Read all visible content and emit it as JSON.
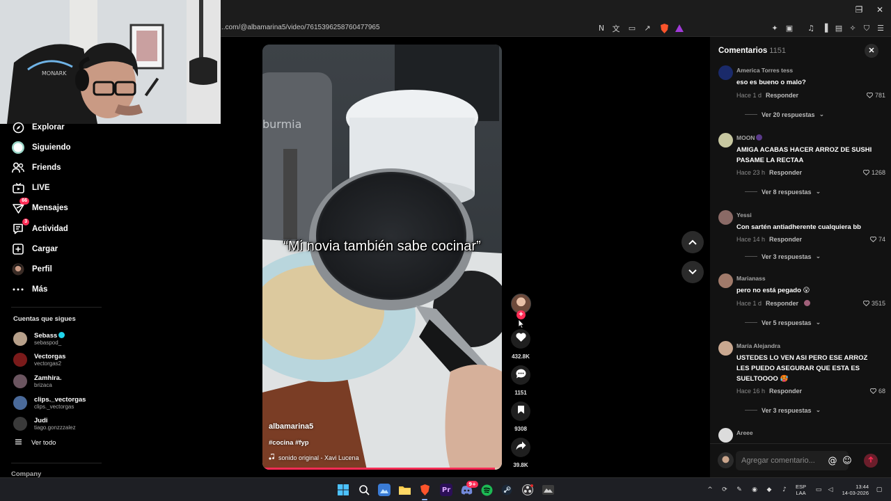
{
  "browser": {
    "url": "..com/@albamarina5/video/7615396258760477965",
    "window_controls": {
      "minimize": "─",
      "maximize": "❐",
      "close": "✕"
    }
  },
  "sidebar": {
    "nav": [
      {
        "label": "Explorar",
        "icon": "compass-icon"
      },
      {
        "label": "Siguiendo",
        "icon": "following-icon"
      },
      {
        "label": "Friends",
        "icon": "friends-icon"
      },
      {
        "label": "LIVE",
        "icon": "live-icon"
      },
      {
        "label": "Mensajes",
        "icon": "messages-icon",
        "badge": "66"
      },
      {
        "label": "Actividad",
        "icon": "activity-icon",
        "badge": "3"
      },
      {
        "label": "Cargar",
        "icon": "upload-icon"
      },
      {
        "label": "Perfil",
        "icon": "profile-icon"
      },
      {
        "label": "Más",
        "icon": "more-icon"
      }
    ],
    "following_title": "Cuentas que sigues",
    "accounts": [
      {
        "name": "Sebass",
        "handle": "sebaspod_",
        "verified": true,
        "color": "#b7a08a"
      },
      {
        "name": "Vectorgas",
        "handle": "vectorgas2",
        "verified": false,
        "color": "#7a1a1a"
      },
      {
        "name": "Zamhira.",
        "handle": "brizaca",
        "verified": false,
        "color": "#6b5560"
      },
      {
        "name": "clips._vectorgas",
        "handle": "clips._vectorgas",
        "verified": false,
        "color": "#4a6a9a"
      },
      {
        "name": "Judi",
        "handle": "tiago.gonzzzalez",
        "verified": false,
        "color": "#3a3a3a"
      }
    ],
    "see_all": "Ver todo",
    "company": "Company"
  },
  "video": {
    "caption": "“Mi novia también sabe cocinar”",
    "author": "albamarina5",
    "tags": "#cocina #fyp",
    "sound": "sonido original - Xavi Lucena",
    "progress": 0.97,
    "likes": "432.8K",
    "comments": "1151",
    "saves": "9308",
    "shares": "39.8K"
  },
  "comments_panel": {
    "title": "Comentarios",
    "count": "1151",
    "items": [
      {
        "user": "America Torres tess",
        "text": "eso es bueno o malo?",
        "time": "Hace 1 d",
        "reply": "Responder",
        "likes": "781",
        "more": "Ver 20 respuestas",
        "avatar_color": "#1a2a6a"
      },
      {
        "user": "MOON",
        "text": "AMIGA ACABAS HACER ARROZ DE SUSHI PASAME LA RECTAA",
        "time": "Hace 23 h",
        "reply": "Responder",
        "likes": "1268",
        "more": "Ver 8 respuestas",
        "avatar_color": "#c7c7a0"
      },
      {
        "user": "Yessi",
        "text": "Con sartén antiadherente cualquiera bb",
        "time": "Hace 14 h",
        "reply": "Responder",
        "likes": "74",
        "more": "Ver 3 respuestas",
        "avatar_color": "#8a6a66"
      },
      {
        "user": "Marianass",
        "text": "pero no está pegado 😮",
        "time": "Hace 1 d",
        "reply": "Responder",
        "likes": "3515",
        "more": "Ver 5 respuestas",
        "avatar_color": "#a07a6a"
      },
      {
        "user": "María Alejandra",
        "text": "USTEDES LO VEN ASI PERO ESE ARROZ LES PUEDO ASEGURAR QUE ESTA ES SUELTOOOO 🥵",
        "time": "Hace 16 h",
        "reply": "Responder",
        "likes": "68",
        "more": "Ver 3 respuestas",
        "avatar_color": "#c9a890"
      },
      {
        "user": "Areee",
        "avatar_color": "#dcdcdc"
      }
    ],
    "input_placeholder": "Agregar comentario..."
  },
  "taskbar": {
    "lang_top": "ESP",
    "lang_bottom": "LAA",
    "time": "13:44",
    "date": "14-03-2026",
    "discord_badge": "9+"
  },
  "colors": {
    "accent": "#fe2c55",
    "verified": "#20d5ec",
    "panel": "#121212"
  }
}
